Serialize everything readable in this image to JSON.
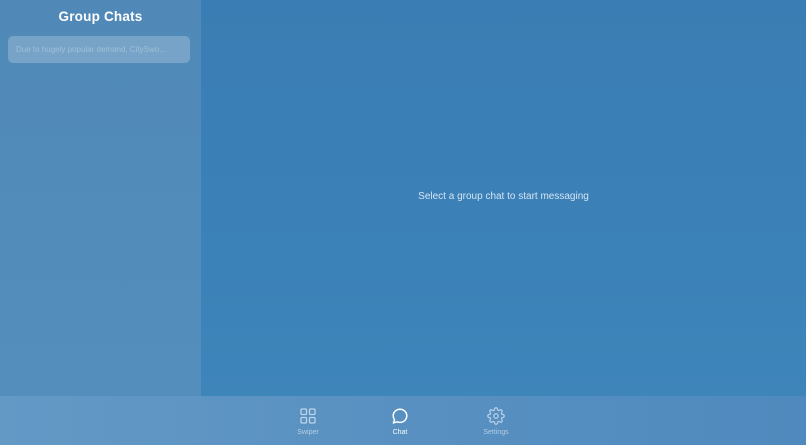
{
  "sidebar": {
    "title": "Group Chats",
    "chats": [
      {
        "preview": "Due to hugely popular demand, CitySwo..."
      }
    ]
  },
  "main": {
    "empty_message": "Select a group chat to start messaging"
  },
  "nav": {
    "items": [
      {
        "label": "Swiper",
        "icon": "grid-icon",
        "active": false
      },
      {
        "label": "Chat",
        "icon": "chat-bubble-icon",
        "active": true
      },
      {
        "label": "Settings",
        "icon": "gear-icon",
        "active": false
      }
    ]
  },
  "colors": {
    "background": "#3b82b8",
    "sidebar": "#528cba",
    "nav_bar": "#5a92c2",
    "text_primary": "#ffffff"
  }
}
